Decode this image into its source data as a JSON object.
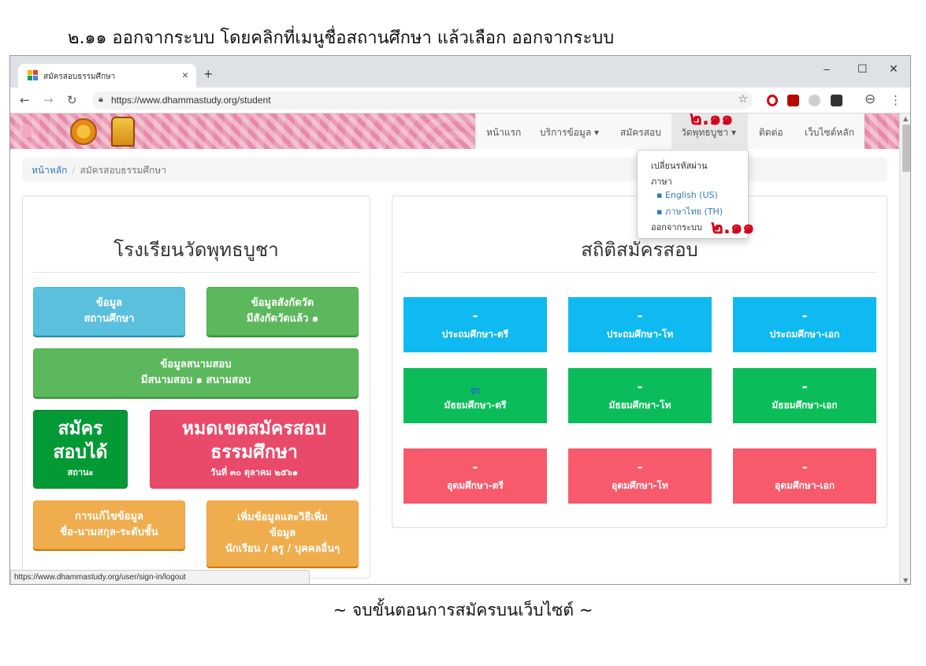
{
  "document": {
    "heading": "๒.๑๑ ออกจากระบบ โดยคลิกที่เมนูชื่อสถานศึกษา แล้วเลือก ออกจากระบบ",
    "footer": "~ จบขั้นตอนการสมัครบนเว็บไซต์ ~"
  },
  "browser": {
    "tab_title": "สมัครสอบธรรมศึกษา",
    "tab_close": "×",
    "new_tab": "+",
    "url": "https://www.dhammastudy.org/student",
    "status_url": "https://www.dhammastudy.org/user/sign-in/logout",
    "window": {
      "minimize": "–",
      "maximize": "☐",
      "close": "✕"
    }
  },
  "navbar": {
    "items": [
      "หน้าแรก",
      "บริการข้อมูล ▾",
      "สมัครสอบ",
      "วัดพุทธบูชา ▾",
      "ติดต่อ",
      "เว็บไซต์หลัก"
    ],
    "step_marker": "๒.๑๑"
  },
  "dropdown": {
    "change_password": "เปลี่ยนรหัสผ่าน",
    "language_label": "ภาษา",
    "lang_en": "▪ English (US)",
    "lang_th": "▪ ภาษาไทย (TH)",
    "logout": "ออกจากระบบ",
    "step_marker": "๒.๑๑"
  },
  "breadcrumb": {
    "home": "หน้าหลัก",
    "separator": "/",
    "current": "สมัครสอบธรรมศึกษา"
  },
  "left_panel": {
    "title": "โรงเรียนวัดพุทธบูชา",
    "btn_school_1": "ข้อมูล",
    "btn_school_2": "สถานศึกษา",
    "btn_affiliation_1": "ข้อมูลสังกัดวัด",
    "btn_affiliation_2": "มีสังกัดวัดแล้ว ๑",
    "btn_venue_1": "ข้อมูลสนามสอบ",
    "btn_venue_2": "มีสนามสอบ ๑ สนามสอบ",
    "btn_can_apply_1": "สมัคร",
    "btn_can_apply_2": "สอบได้",
    "btn_can_apply_3": "สถานะ",
    "btn_deadline_1": "หมดเขตสมัครสอบ",
    "btn_deadline_2": "ธรรมศึกษา",
    "btn_deadline_3": "วันที่ ๓๐ ตุลาคม ๒๕๖๑",
    "btn_edit_1": "การแก้ไขข้อมูล",
    "btn_edit_2": "ชื่อ-นามสกุล-ระดับชั้น",
    "btn_add_1": "เพิ่มข้อมูลและวิธีเพิ่ม",
    "btn_add_2": "ข้อมูล",
    "btn_add_3": "นักเรียน / ครู / บุคคลอื่นๆ"
  },
  "right_panel": {
    "title": "สถิติสมัครสอบ",
    "stats": [
      {
        "value": "-",
        "label": "ประถมศึกษา-ตรี"
      },
      {
        "value": "-",
        "label": "ประถมศึกษา-โท"
      },
      {
        "value": "-",
        "label": "ประถมศึกษา-เอก"
      },
      {
        "value": "๓",
        "label": "มัธยมศึกษา-ตรี"
      },
      {
        "value": "-",
        "label": "มัธยมศึกษา-โท"
      },
      {
        "value": "-",
        "label": "มัธยมศึกษา-เอก"
      },
      {
        "value": "-",
        "label": "อุดมศึกษา-ตรี"
      },
      {
        "value": "-",
        "label": "อุดมศึกษา-โท"
      },
      {
        "value": "-",
        "label": "อุดมศึกษา-เอก"
      }
    ]
  },
  "colors": {
    "info": "#5bc0de",
    "success": "#5cb85c",
    "warning": "#f0ad4e",
    "danger": "#e94a6a",
    "stat_blue": "#0fb9f2",
    "stat_green": "#0bbd5a",
    "stat_red": "#f75a6b",
    "annotation": "#d0021b"
  },
  "icons": [
    "back-icon",
    "forward-icon",
    "reload-icon",
    "lock-icon",
    "star-icon",
    "opera-icon",
    "pdf-icon",
    "extension-icon",
    "save-icon",
    "profile-icon",
    "menu-icon"
  ]
}
